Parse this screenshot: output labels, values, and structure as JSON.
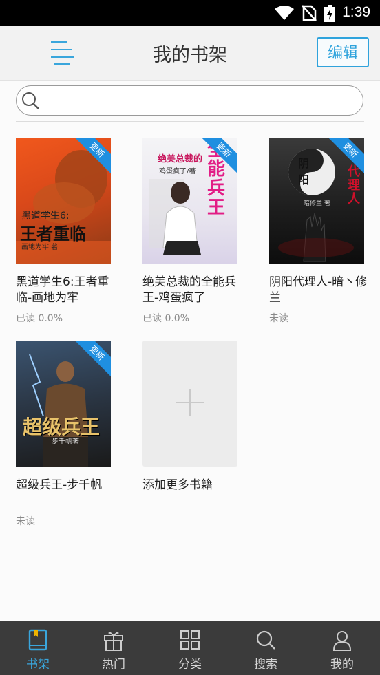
{
  "status_bar": {
    "time": "1:39"
  },
  "header": {
    "title": "我的书架",
    "edit_label": "编辑"
  },
  "search": {
    "placeholder": ""
  },
  "books": [
    {
      "name": "黑道学生6:王者重临-画地为牢",
      "progress": "已读 0.0%",
      "badge": "更新",
      "cover": {
        "title": "王者重临",
        "subtitle": "黑道学生6:",
        "author": "画地为牢 著",
        "colors": [
          "#f1581c",
          "#8b3a16"
        ]
      }
    },
    {
      "name": "绝美总裁的全能兵王-鸡蛋疯了",
      "progress": "已读 0.0%",
      "badge": "更新",
      "cover": {
        "title": "全能兵王",
        "subtitle": "绝美总裁的",
        "author": "鸡蛋疯了/著",
        "colors": [
          "#f4f4f6",
          "#d9d2e8"
        ]
      }
    },
    {
      "name": "阴阳代理人-暗丶修兰",
      "progress": "未读",
      "badge": "更新",
      "cover": {
        "title": "代理人",
        "subtitle": "阴 阳",
        "author": "暗修兰 著",
        "colors": [
          "#3a3a3a",
          "#0d0d0d"
        ]
      }
    },
    {
      "name": "超级兵王-步千帆",
      "progress": "未读",
      "badge": "更新",
      "cover": {
        "title": "超级兵王",
        "subtitle": "",
        "author": "步千帆著",
        "colors": [
          "#3b5470",
          "#1a1a1a"
        ]
      }
    }
  ],
  "add_more": {
    "label": "添加更多书籍"
  },
  "tabs": [
    {
      "label": "书架",
      "icon": "book-icon",
      "active": true
    },
    {
      "label": "热门",
      "icon": "gift-icon",
      "active": false
    },
    {
      "label": "分类",
      "icon": "grid-icon",
      "active": false
    },
    {
      "label": "搜索",
      "icon": "search-icon",
      "active": false
    },
    {
      "label": "我的",
      "icon": "user-icon",
      "active": false
    }
  ],
  "colors": {
    "accent": "#3aa6dc",
    "ribbon": "#1f8fe0",
    "tabbar_bg": "#3b3b3b"
  }
}
